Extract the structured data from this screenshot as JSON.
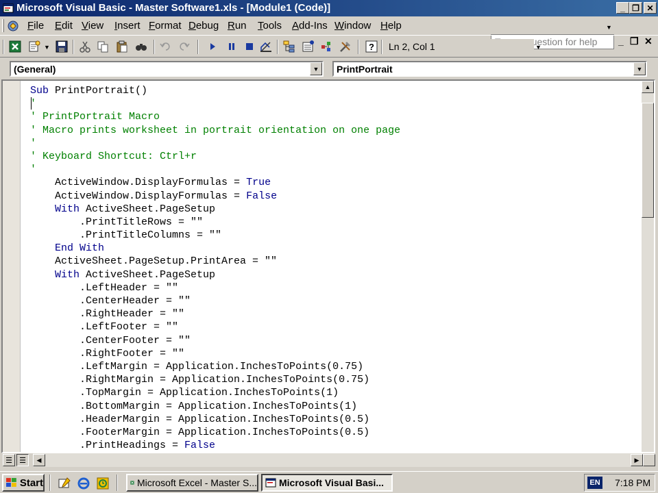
{
  "window": {
    "title": "Microsoft Visual Basic - Master Software1.xls - [Module1 (Code)]",
    "minimize_glyph": "_",
    "restore_glyph": "❐",
    "close_glyph": "✕"
  },
  "menubar": {
    "items": [
      {
        "label": "File",
        "u": "F",
        "rest": "ile"
      },
      {
        "label": "Edit",
        "u": "E",
        "rest": "dit"
      },
      {
        "label": "View",
        "u": "V",
        "rest": "iew"
      },
      {
        "label": "Insert",
        "u": "I",
        "rest": "nsert"
      },
      {
        "label": "Format",
        "u": "F",
        "rest": "ormat",
        "prefix": ""
      },
      {
        "label": "Debug",
        "u": "D",
        "rest": "ebug"
      },
      {
        "label": "Run",
        "u": "R",
        "rest": "un"
      },
      {
        "label": "Tools",
        "u": "T",
        "rest": "ools"
      },
      {
        "label": "Add-Ins",
        "u": "A",
        "rest": "dd-Ins"
      },
      {
        "label": "Window",
        "u": "W",
        "rest": "indow"
      },
      {
        "label": "Help",
        "u": "H",
        "rest": "elp"
      }
    ],
    "help_placeholder": "Type a question for help",
    "mdi_minimize": "_",
    "mdi_restore": "❐",
    "mdi_close": "✕"
  },
  "toolbar": {
    "cursor_position": "Ln 2, Col 1",
    "icons": [
      "excel-icon",
      "insert-module-icon",
      "save-icon",
      "cut-icon",
      "copy-icon",
      "paste-icon",
      "find-icon",
      "undo-icon",
      "redo-icon",
      "run-icon",
      "break-icon",
      "reset-icon",
      "design-mode-icon",
      "project-explorer-icon",
      "properties-icon",
      "object-browser-icon",
      "toolbox-icon",
      "help-icon"
    ]
  },
  "object_combo": {
    "value": "(General)"
  },
  "procedure_combo": {
    "value": "PrintPortrait"
  },
  "code": {
    "lines": [
      [
        {
          "t": "Sub ",
          "c": "kw"
        },
        {
          "t": "PrintPortrait()",
          "c": "tx"
        }
      ],
      [
        {
          "t": "'",
          "c": "cm"
        }
      ],
      [
        {
          "t": "' PrintPortrait Macro",
          "c": "cm"
        }
      ],
      [
        {
          "t": "' Macro prints worksheet in portrait orientation on one page",
          "c": "cm"
        }
      ],
      [
        {
          "t": "'",
          "c": "cm"
        }
      ],
      [
        {
          "t": "' Keyboard Shortcut: Ctrl+r",
          "c": "cm"
        }
      ],
      [
        {
          "t": "'",
          "c": "cm"
        }
      ],
      [
        {
          "t": "    ActiveWindow.DisplayFormulas = ",
          "c": "tx"
        },
        {
          "t": "True",
          "c": "kw"
        }
      ],
      [
        {
          "t": "    ActiveWindow.DisplayFormulas = ",
          "c": "tx"
        },
        {
          "t": "False",
          "c": "kw"
        }
      ],
      [
        {
          "t": "    ",
          "c": "tx"
        },
        {
          "t": "With ",
          "c": "kw"
        },
        {
          "t": "ActiveSheet.PageSetup",
          "c": "tx"
        }
      ],
      [
        {
          "t": "        .PrintTitleRows = \"\"",
          "c": "tx"
        }
      ],
      [
        {
          "t": "        .PrintTitleColumns = \"\"",
          "c": "tx"
        }
      ],
      [
        {
          "t": "    ",
          "c": "tx"
        },
        {
          "t": "End With",
          "c": "kw"
        }
      ],
      [
        {
          "t": "    ActiveSheet.PageSetup.PrintArea = \"\"",
          "c": "tx"
        }
      ],
      [
        {
          "t": "    ",
          "c": "tx"
        },
        {
          "t": "With ",
          "c": "kw"
        },
        {
          "t": "ActiveSheet.PageSetup",
          "c": "tx"
        }
      ],
      [
        {
          "t": "        .LeftHeader = \"\"",
          "c": "tx"
        }
      ],
      [
        {
          "t": "        .CenterHeader = \"\"",
          "c": "tx"
        }
      ],
      [
        {
          "t": "        .RightHeader = \"\"",
          "c": "tx"
        }
      ],
      [
        {
          "t": "        .LeftFooter = \"\"",
          "c": "tx"
        }
      ],
      [
        {
          "t": "        .CenterFooter = \"\"",
          "c": "tx"
        }
      ],
      [
        {
          "t": "        .RightFooter = \"\"",
          "c": "tx"
        }
      ],
      [
        {
          "t": "        .LeftMargin = Application.InchesToPoints(0.75)",
          "c": "tx"
        }
      ],
      [
        {
          "t": "        .RightMargin = Application.InchesToPoints(0.75)",
          "c": "tx"
        }
      ],
      [
        {
          "t": "        .TopMargin = Application.InchesToPoints(1)",
          "c": "tx"
        }
      ],
      [
        {
          "t": "        .BottomMargin = Application.InchesToPoints(1)",
          "c": "tx"
        }
      ],
      [
        {
          "t": "        .HeaderMargin = Application.InchesToPoints(0.5)",
          "c": "tx"
        }
      ],
      [
        {
          "t": "        .FooterMargin = Application.InchesToPoints(0.5)",
          "c": "tx"
        }
      ],
      [
        {
          "t": "        .PrintHeadings = ",
          "c": "tx"
        },
        {
          "t": "False",
          "c": "kw"
        }
      ]
    ]
  },
  "colors": {
    "keyword": "#00008b",
    "comment": "#008000",
    "titlebar": "#0a246a"
  },
  "taskbar": {
    "start_label": "Start",
    "tasks": [
      {
        "label": "Microsoft Excel - Master S...",
        "active": false
      },
      {
        "label": "Microsoft Visual Basi...",
        "active": true
      }
    ],
    "language": "EN",
    "clock": "7:18 PM"
  }
}
